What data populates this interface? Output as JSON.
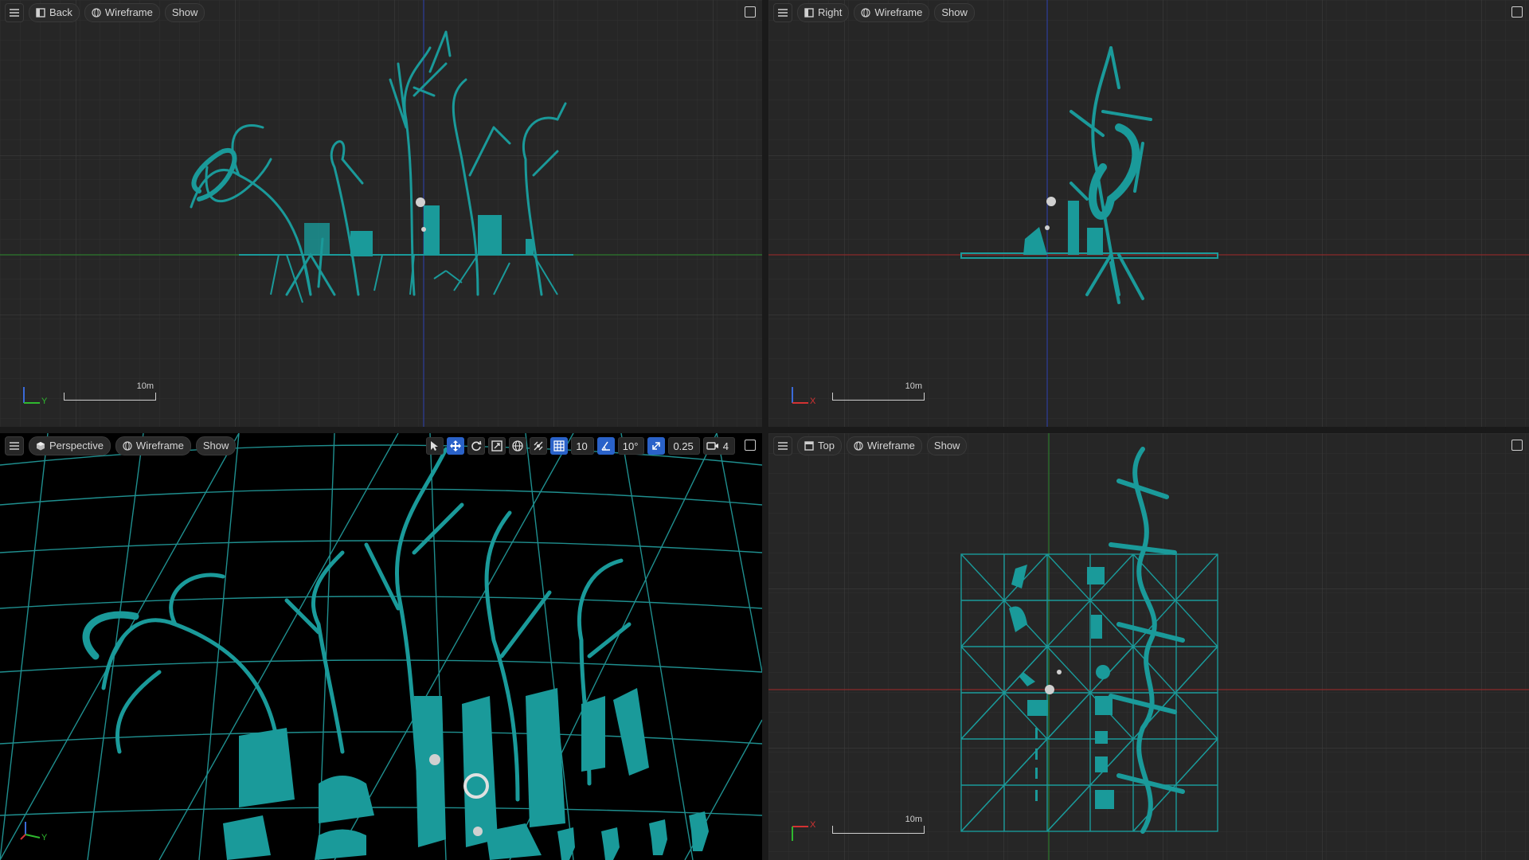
{
  "viewports": {
    "back": {
      "view_label": "Back",
      "mode_label": "Wireframe",
      "show_label": "Show",
      "scale_label": "10m",
      "axis_h": "Y"
    },
    "right": {
      "view_label": "Right",
      "mode_label": "Wireframe",
      "show_label": "Show",
      "scale_label": "10m",
      "axis_h": "X"
    },
    "perspective": {
      "view_label": "Perspective",
      "mode_label": "Wireframe",
      "show_label": "Show",
      "axis_h": "Y",
      "tools": {
        "grid_snap_value": "10",
        "rotate_snap_value": "10°",
        "scale_snap_value": "0.25",
        "camera_speed_value": "4"
      }
    },
    "top": {
      "view_label": "Top",
      "mode_label": "Wireframe",
      "show_label": "Show",
      "scale_label": "10m",
      "axis_h": "X"
    }
  },
  "colors": {
    "mesh": "#1a9a9a",
    "grid_bg": "#262626",
    "persp_bg": "#000000",
    "active_blue": "#2a62c9",
    "axis_x": "#d23232",
    "axis_y": "#2fb82f",
    "axis_z": "#3a6ad8"
  }
}
